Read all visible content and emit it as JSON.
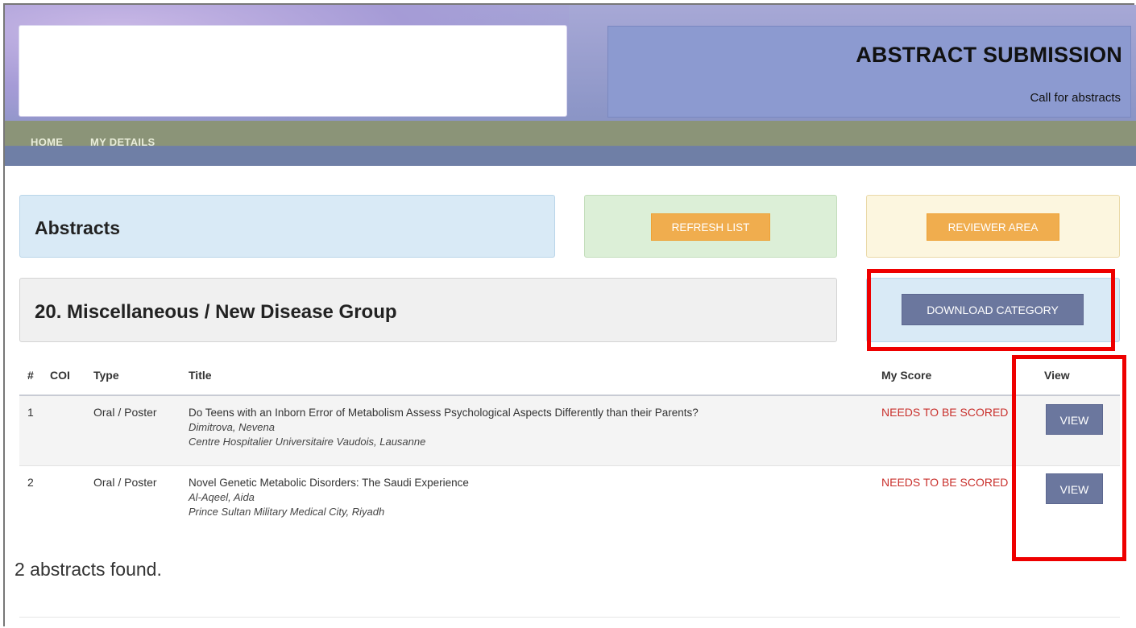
{
  "header": {
    "title": "ABSTRACT SUBMISSION",
    "subtitle": "Call for abstracts"
  },
  "nav": {
    "items": [
      {
        "label": "HOME"
      },
      {
        "label": "MY DETAILS"
      }
    ]
  },
  "abstracts_panel": {
    "heading": "Abstracts"
  },
  "actions": {
    "refresh_label": "REFRESH LIST",
    "reviewer_label": "REVIEWER AREA"
  },
  "category": {
    "heading": "20. Miscellaneous / New Disease Group",
    "download_label": "DOWNLOAD CATEGORY"
  },
  "table": {
    "columns": [
      "#",
      "COI",
      "Type",
      "Title",
      "My Score",
      "View"
    ],
    "rows": [
      {
        "num": "1",
        "coi": "",
        "type": "Oral / Poster",
        "title": "Do Teens with an Inborn Error of Metabolism Assess Psychological Aspects Differently than their Parents?",
        "author": "Dimitrova, Nevena",
        "institution": "Centre Hospitalier Universitaire Vaudois, Lausanne",
        "score": "NEEDS TO BE SCORED",
        "view_label": "VIEW"
      },
      {
        "num": "2",
        "coi": "",
        "type": "Oral / Poster",
        "title": "Novel Genetic Metabolic Disorders: The Saudi Experience",
        "author": "Al-Aqeel, Aida",
        "institution": "Prince Sultan Military Medical City, Riyadh",
        "score": "NEEDS TO BE SCORED",
        "view_label": "VIEW"
      }
    ]
  },
  "footer": {
    "found_text": "2 abstracts found."
  },
  "colors": {
    "accent_orange": "#f0ad4e",
    "button_slate": "#6b779e",
    "score_red": "#c9302c",
    "highlight_red": "#ee0000"
  }
}
